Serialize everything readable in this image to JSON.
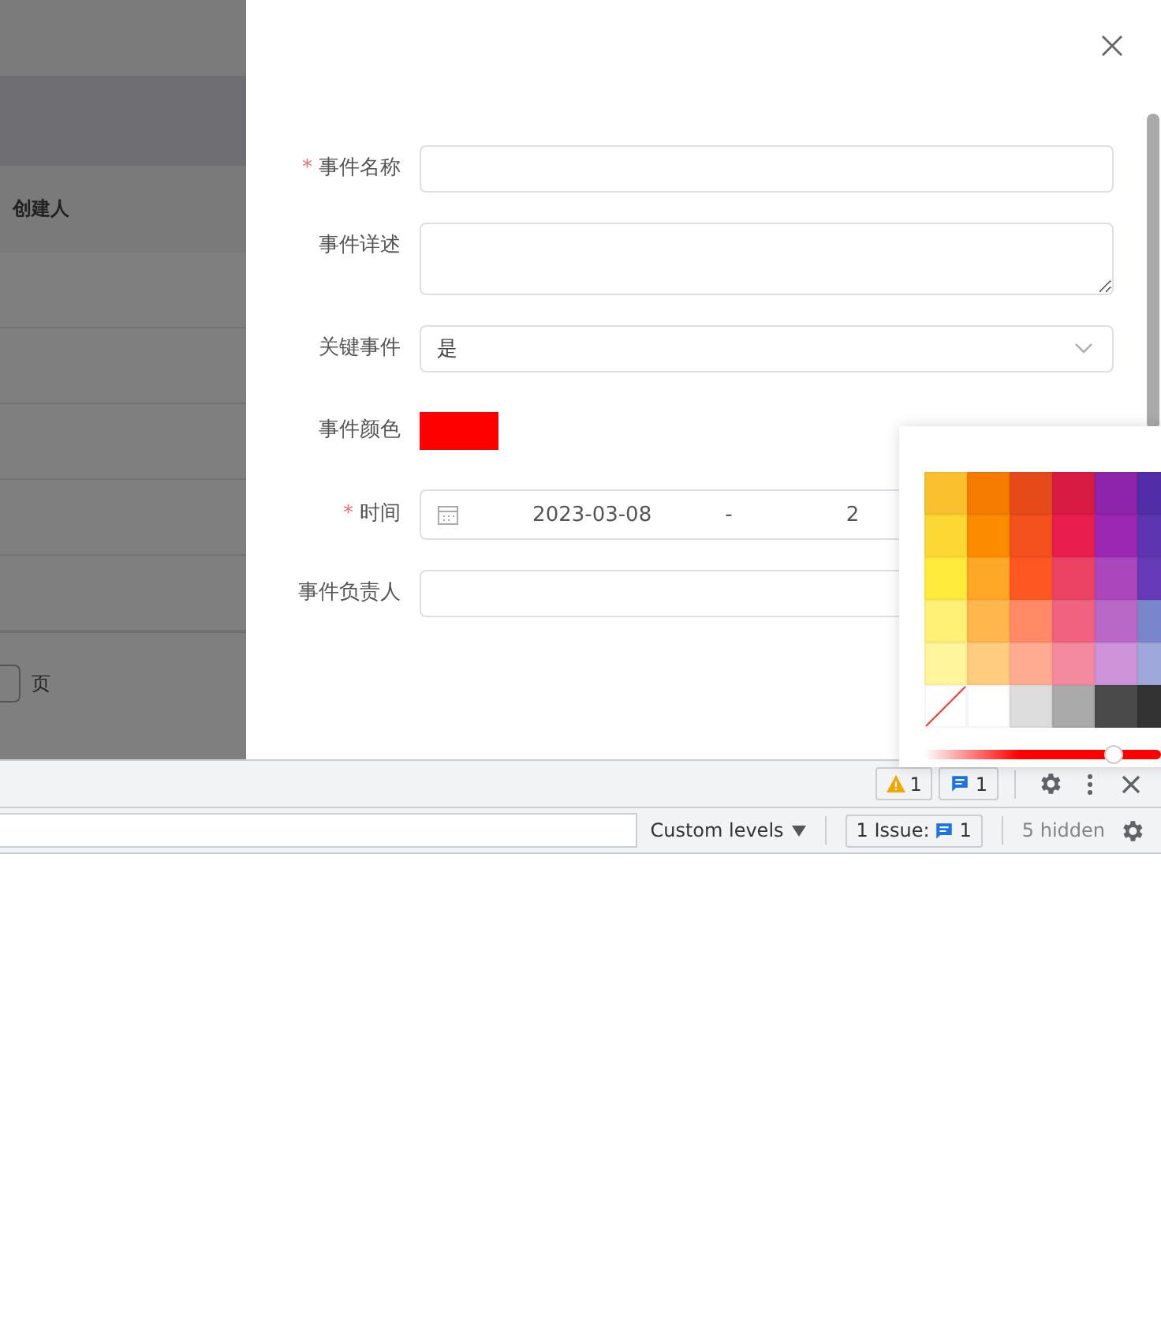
{
  "background_page": {
    "table": {
      "header": "创建人"
    },
    "pager": {
      "unit": "页"
    }
  },
  "drawer": {
    "required_mark": "*",
    "fields": [
      {
        "kind": "text",
        "label": "事件名称",
        "required": true
      },
      {
        "kind": "textarea",
        "label": "事件详述",
        "required": false
      },
      {
        "kind": "select",
        "label": "关键事件",
        "required": false,
        "value": "是"
      },
      {
        "kind": "color",
        "label": "事件颜色",
        "required": false,
        "color": "#ff0000"
      },
      {
        "kind": "daterange",
        "label": "时间",
        "required": true,
        "start": "2023-03-08",
        "separator": "-",
        "end": "2"
      },
      {
        "kind": "text",
        "label": "事件负责人",
        "required": false
      }
    ]
  },
  "color_picker": {
    "swatches": [
      {
        "kind": "color",
        "color": "#fbc02d"
      },
      {
        "kind": "color",
        "color": "#f57c00"
      },
      {
        "kind": "color",
        "color": "#e64a19"
      },
      {
        "kind": "color",
        "color": "#d81b43"
      },
      {
        "kind": "color",
        "color": "#8e24aa"
      },
      {
        "kind": "color",
        "color": "#512da8"
      },
      {
        "kind": "color",
        "color": "#fdd835"
      },
      {
        "kind": "color",
        "color": "#fb8c00"
      },
      {
        "kind": "color",
        "color": "#f4511e"
      },
      {
        "kind": "color",
        "color": "#e91e4f"
      },
      {
        "kind": "color",
        "color": "#9c27b0"
      },
      {
        "kind": "color",
        "color": "#5e35b1"
      },
      {
        "kind": "color",
        "color": "#ffeb3b"
      },
      {
        "kind": "color",
        "color": "#ffa726"
      },
      {
        "kind": "color",
        "color": "#ff5722"
      },
      {
        "kind": "color",
        "color": "#ec4364"
      },
      {
        "kind": "color",
        "color": "#ab47bc"
      },
      {
        "kind": "color",
        "color": "#673ab7"
      },
      {
        "kind": "color",
        "color": "#fff176"
      },
      {
        "kind": "color",
        "color": "#ffb74d"
      },
      {
        "kind": "color",
        "color": "#ff8a65"
      },
      {
        "kind": "color",
        "color": "#f06280"
      },
      {
        "kind": "color",
        "color": "#ba68c8"
      },
      {
        "kind": "color",
        "color": "#7986cb"
      },
      {
        "kind": "color",
        "color": "#fff59d"
      },
      {
        "kind": "color",
        "color": "#ffcc80"
      },
      {
        "kind": "color",
        "color": "#ffab91"
      },
      {
        "kind": "color",
        "color": "#f48aa0"
      },
      {
        "kind": "color",
        "color": "#ce93d8"
      },
      {
        "kind": "color",
        "color": "#9fa8da"
      },
      {
        "kind": "none"
      },
      {
        "kind": "color",
        "color": "#ffffff"
      },
      {
        "kind": "color",
        "color": "#dddddd"
      },
      {
        "kind": "color",
        "color": "#aaaaaa"
      },
      {
        "kind": "color",
        "color": "#4a4a4a"
      },
      {
        "kind": "color",
        "color": "#333333"
      }
    ],
    "hue": {
      "level": 0.8
    }
  },
  "devtools": {
    "toolbar": {
      "warnings": "1",
      "messages": "1"
    },
    "console_bar": {
      "levels": "Custom levels",
      "issues_label": "1 Issue:",
      "issues_count": "1",
      "hidden": "5 hidden"
    }
  }
}
